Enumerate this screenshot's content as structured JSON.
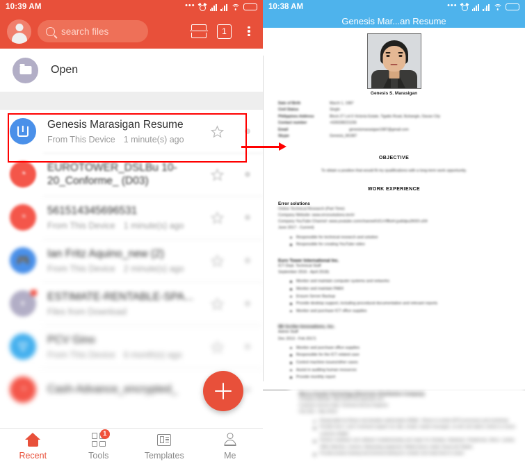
{
  "left": {
    "status_bar": {
      "time": "10:39 AM",
      "icons": [
        "ellipsis-icon",
        "alarm-icon",
        "signal-icon",
        "signal-icon",
        "wifi-icon",
        "battery-icon"
      ]
    },
    "appbar": {
      "avatar": "user-avatar",
      "search_placeholder": "search files",
      "split_screen_icon": "split-screen-icon",
      "tab_count": "1",
      "overflow_icon": "overflow-menu-icon"
    },
    "open_row": {
      "label": "Open",
      "icon": "folder-icon"
    },
    "files": [
      {
        "name": "Genesis Marasigan Resume",
        "source": "From This Device",
        "time": "1 minute(s) ago",
        "icon": "word-document-icon",
        "icon_color": "#4a90e9",
        "highlighted": true,
        "blur": 0
      },
      {
        "name": "EUROTOWER_DSLBu 10-20_Conforme_ (D03)",
        "source": "",
        "time": "",
        "icon": "pdf-document-icon",
        "icon_color": "#f4564a",
        "highlighted": false,
        "blur": 1
      },
      {
        "name": "561514345696531",
        "source": "From This Device",
        "time": "1 minute(s) ago",
        "icon": "pdf-document-icon",
        "icon_color": "#f4564a",
        "highlighted": false,
        "blur": 2
      },
      {
        "name": "Ian Fritz Aquino_new (2)",
        "source": "From This Device",
        "time": "2 minute(s) ago",
        "icon": "game-file-icon",
        "icon_color": "#4a90e9",
        "highlighted": false,
        "blur": 3
      },
      {
        "name": "ESTIMATE-RENTABLE-SPA...",
        "source": "Files from Download",
        "time": "",
        "icon": "archive-file-icon",
        "icon_color": "#b2aec6",
        "highlighted": false,
        "blur": 4
      },
      {
        "name": "PCV Gino",
        "source": "From This Device",
        "time": "6 month(s) ago",
        "icon": "excel-document-icon",
        "icon_color": "#44b0ee",
        "highlighted": false,
        "blur": 5
      },
      {
        "name": "Cash-Advance_encrypted_",
        "source": "",
        "time": "",
        "icon": "pdf-document-icon",
        "icon_color": "#f4564a",
        "highlighted": false,
        "blur": 6
      }
    ],
    "fab": {
      "icon": "add-plus-icon"
    },
    "bottom_nav": [
      {
        "label": "Recent",
        "icon": "home-icon",
        "active": true,
        "badge": ""
      },
      {
        "label": "Tools",
        "icon": "grid-tools-icon",
        "active": false,
        "badge": "1"
      },
      {
        "label": "Templates",
        "icon": "templates-icon",
        "active": false,
        "badge": ""
      },
      {
        "label": "Me",
        "icon": "person-icon",
        "active": false,
        "badge": ""
      }
    ],
    "accent_color": "#e8503a",
    "highlight_color": "#ff0000"
  },
  "right": {
    "status_bar": {
      "time": "10:38 AM"
    },
    "title": "Genesis Mar...an Resume",
    "accent_color": "#4eb3ec",
    "document": {
      "photo_caption": "Genesis S. Marasigan",
      "info": [
        {
          "label": "Date of Birth",
          "value": "March 1, 1987"
        },
        {
          "label": "Civil Status",
          "value": "Single"
        },
        {
          "label": "Philippines Address",
          "value": "Block 27 Lot 6 Victoria Estate, Tigatto Road, Buhangin, Davao City"
        },
        {
          "label": "Contact number",
          "value": "+639338221156"
        },
        {
          "label": "Email",
          "value": "genesismarasigan1987@gmail.com"
        },
        {
          "label": "Skype",
          "value": "Genesis_M1987"
        }
      ],
      "objective_heading": "OBJECTIVE",
      "objective_text": "To obtain a position that would fit my qualifications with a long-term work opportunity.",
      "work_heading": "WORK EXPERIENCE",
      "jobs": [
        {
          "title": "Error solutions",
          "lines": [
            "Online Technical Research (Part Time)",
            "Company Website: www.errorsolutions.tech/",
            "Company YouTube Channel: www.youtube.com/channel/UCcVfBoH-jya6dpu2K0O-z04",
            "June 2017 - Current)"
          ],
          "bullets": [
            "Responsible for technical research and solution",
            "Responsible for creating YouTube video"
          ],
          "blur_level": "sharp-title"
        },
        {
          "title": "Euro Tower International Inc.",
          "lines": [
            "ICT Dept. Technical Staff",
            "September 2016 - April 2018)"
          ],
          "bullets": [
            "Monitor and maintain computer systems and networks",
            "Monitor and maintain PABX",
            "Ensure Server Backup",
            "Provide desktop support, including procedural documentation and relevant reports",
            "Monitor and purchase ICT office supplies"
          ],
          "blur_level": "blurred"
        },
        {
          "title": "IBI Scribe Innovations, Inc.",
          "lines": [
            "Admin Staff",
            "Dec 2013 - Feb 2017)"
          ],
          "bullets": [
            "Monitor and purchase office supplies",
            "Responsible for the ICT related case",
            "Control machine issues/other cases",
            "Assist in auditing human resources",
            "Provide monthly report"
          ],
          "blur_level": "blur2"
        }
      ],
      "page2": {
        "title": "Mecca Grande Technology (Electronic Distribution Company)",
        "lines": [
          "Company Website: http://www.meccagrande.com",
          "Customer Service Dept. Technical Service Engineer",
          "Feb 2011 - May 2013)"
        ],
        "bullets": [
          "Responsible for Return merchandise authorization (RMA) - Return to vendor (RTV) processes and monitoring",
          "Provide level 1 and 2 technical support via calls, emails, instant messages, on-site and walk-in clients to ensure customer delight",
          "Perform hardware and software troubleshooting and repair for Desktop, Notebook, Peripherals, Mono / printer, Office Machine, Camera, Networking equipment, Mobile phone, Audio Visual and Tablets",
          "Provide product training and technical training for a dealer and ready fixed on action"
        ]
      }
    }
  }
}
